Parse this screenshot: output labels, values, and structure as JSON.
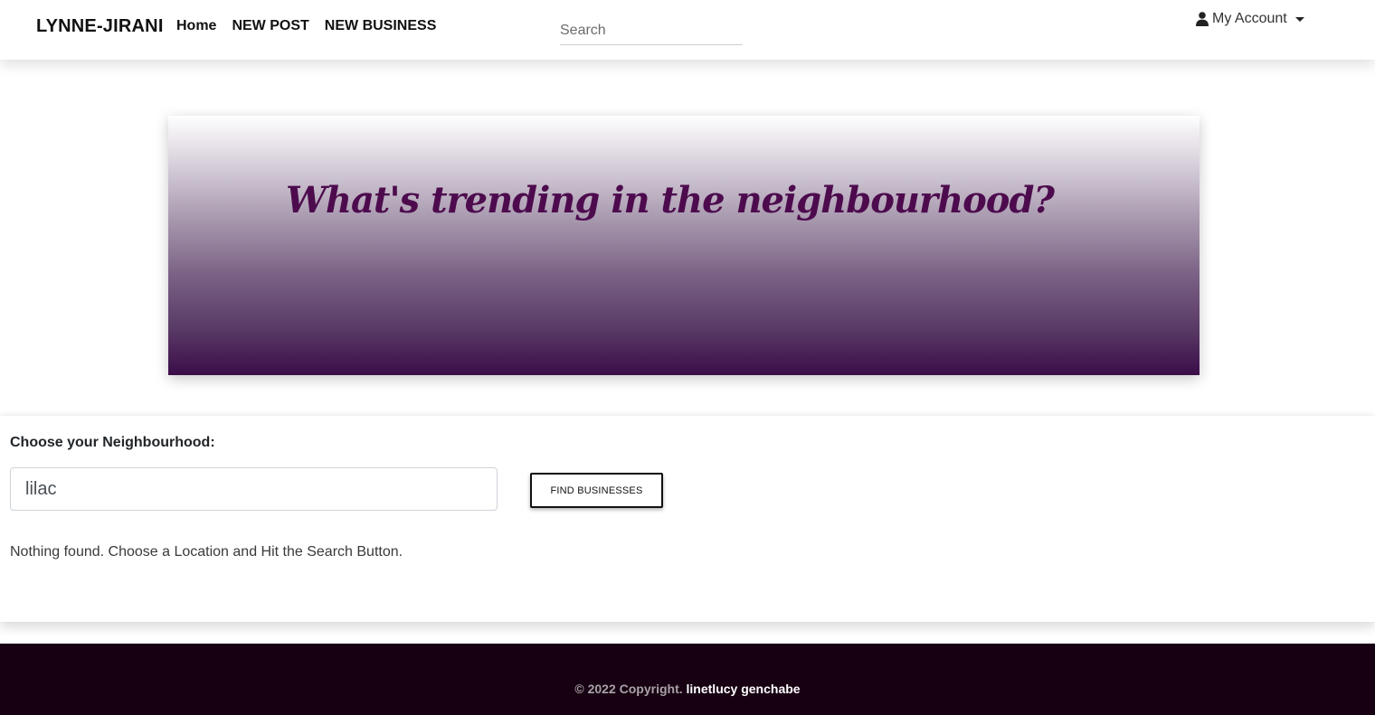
{
  "navbar": {
    "brand": "LYNNE-JIRANI",
    "links": [
      "Home",
      "NEW POST",
      "NEW BUSINESS"
    ],
    "search_placeholder": "Search",
    "account_label": "My Account",
    "account_icon": "user-icon",
    "caret_icon": "caret-down-icon"
  },
  "hero": {
    "title": "What's trending in the neighbourhood?",
    "title_color": "#4d0b4e",
    "gradient_end_color": "#3b0d49"
  },
  "main": {
    "choose_label": "Choose your Neighbourhood:",
    "location_value": "lilac",
    "find_button_label": "FIND BUSINESSES",
    "status_text": "Nothing found. Choose a Location and Hit the Search Button."
  },
  "footer": {
    "copyright": "© 2022 Copyright.",
    "owner": "linetlucy genchabe",
    "background_color": "#170012"
  }
}
